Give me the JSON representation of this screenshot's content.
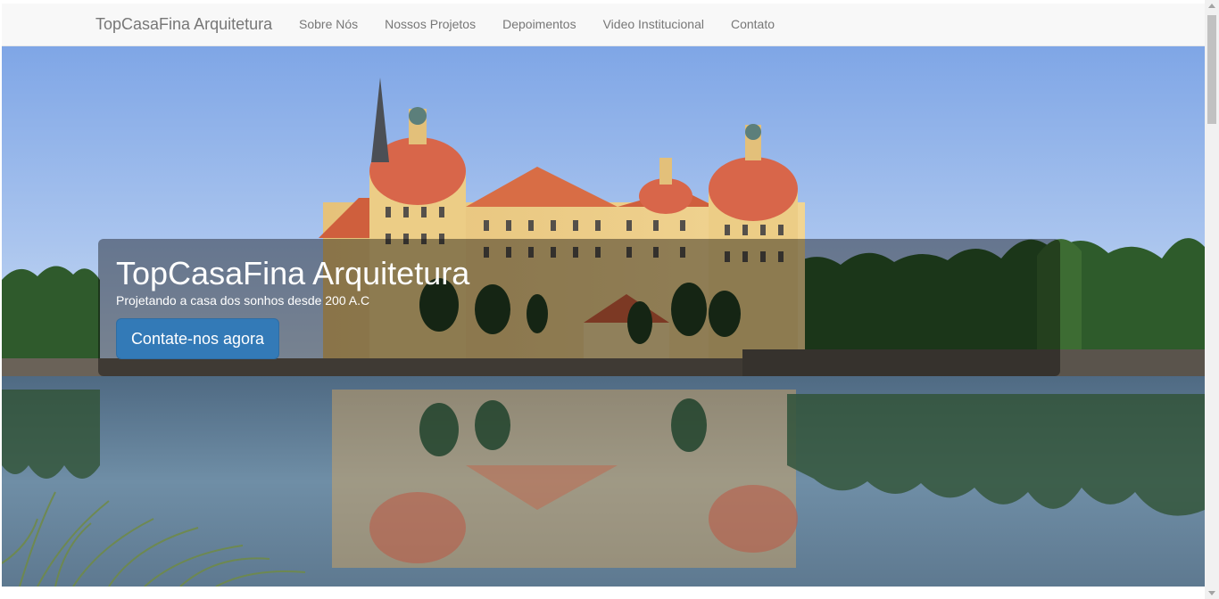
{
  "navbar": {
    "brand": "TopCasaFina Arquitetura",
    "items": [
      "Sobre Nós",
      "Nossos Projetos",
      "Depoimentos",
      "Video Institucional",
      "Contato"
    ]
  },
  "hero": {
    "title": "TopCasaFina Arquitetura",
    "subtitle": "Projetando a casa dos sonhos desde 200 A.C",
    "cta_label": "Contate-nos agora"
  },
  "colors": {
    "navbar_bg": "#f8f8f8",
    "nav_text": "#777777",
    "primary_button": "#337ab7"
  }
}
